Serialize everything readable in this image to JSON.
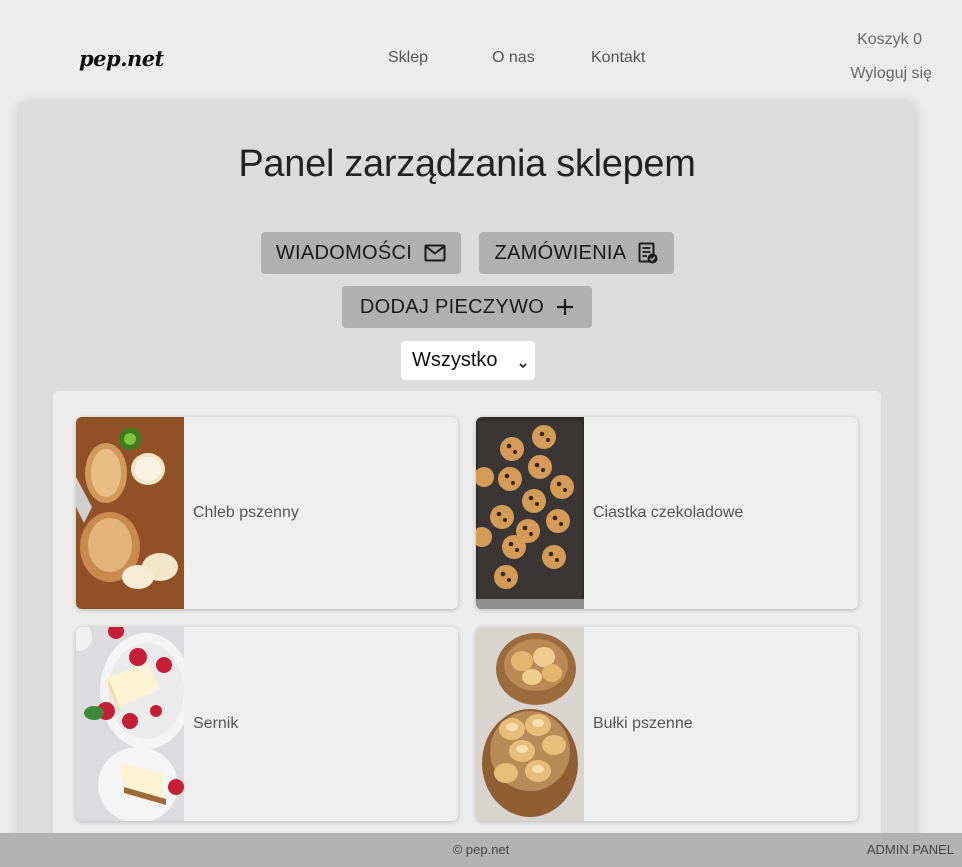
{
  "header": {
    "logo": "pep.net",
    "nav": [
      "Sklep",
      "O nas",
      "Kontakt"
    ],
    "cart_label": "Koszyk 0",
    "logout_label": "Wyloguj się"
  },
  "panel": {
    "title": "Panel zarządzania sklepem",
    "buttons": {
      "messages": "WIADOMOŚCI",
      "orders": "ZAMÓWIENIA",
      "add": "DODAJ PIECZYWO"
    },
    "filter": {
      "selected": "Wszystko"
    }
  },
  "products": [
    {
      "name": "Chleb pszenny",
      "image": "wheat-bread-image"
    },
    {
      "name": "Ciastka czekoladowe",
      "image": "chocolate-cookies-image"
    },
    {
      "name": "Sernik",
      "image": "cheesecake-image"
    },
    {
      "name": "Bułki pszenne",
      "image": "wheat-rolls-image"
    }
  ],
  "footer": {
    "copyright": "© pep.net",
    "admin": "ADMIN PANEL"
  },
  "colors": {
    "page_bg": "#ececec",
    "panel_bg": "#dcdcdc",
    "button_bg": "#b0b0b0",
    "footer_bg": "#b3b3b3"
  },
  "icons": {
    "messages": "envelope-icon",
    "orders": "receipt-check-icon",
    "add": "plus-icon",
    "filter": "chevron-down-icon"
  }
}
